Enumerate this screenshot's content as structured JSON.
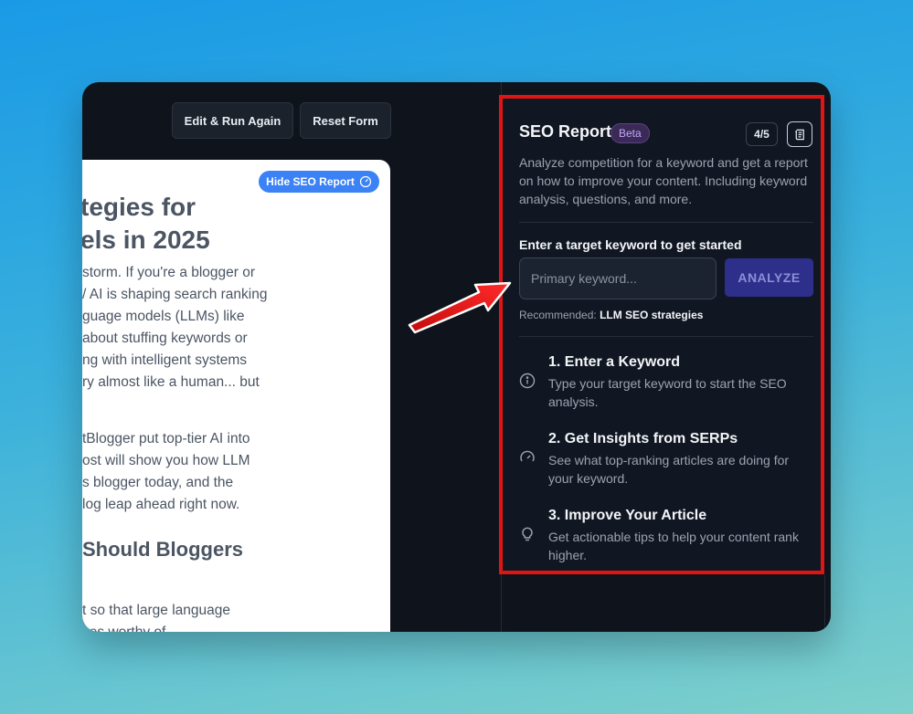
{
  "toolbar": {
    "edit_run_label": "Edit & Run Again",
    "reset_label": "Reset Form"
  },
  "article": {
    "hide_seo_label": "Hide SEO Report",
    "heading_lines": [
      "tegies for",
      "els in 2025"
    ],
    "para1": [
      "storm. If you're a blogger or",
      "/ AI is shaping search ranking",
      "guage models (LLMs) like",
      "about stuffing keywords or",
      "ng with intelligent systems",
      "ry almost like a human... but"
    ],
    "para2": [
      "tBlogger put top-tier AI into",
      "ost will show you how LLM",
      "s blogger today, and the",
      "log leap ahead right now."
    ],
    "subheading": "Should Bloggers",
    "para3": [
      "t so that large language",
      "ces worthy of"
    ]
  },
  "seo": {
    "title": "SEO Report",
    "beta": "Beta",
    "count": "4/5",
    "description": "Analyze competition for a keyword and get a report on how to improve your content. Including keyword analysis, questions, and more.",
    "keyword_label": "Enter a target keyword to get started",
    "keyword_placeholder": "Primary keyword...",
    "analyze_label": "ANALYZE",
    "recommended_prefix": "Recommended:",
    "recommended_value": "LLM SEO strategies",
    "steps": [
      {
        "title": "1. Enter a Keyword",
        "desc": "Type your target keyword to start the SEO analysis.",
        "icon": "info-icon"
      },
      {
        "title": "2. Get Insights from SERPs",
        "desc": "See what top-ranking articles are doing for your keyword.",
        "icon": "gauge-icon"
      },
      {
        "title": "3. Improve Your Article",
        "desc": "Get actionable tips to help your content rank higher.",
        "icon": "lightbulb-icon"
      }
    ]
  },
  "colors": {
    "highlight_border": "#e11414",
    "analyze_bg": "#2e2f8a",
    "hide_seo_bg": "#3b82f6",
    "beta_text": "#c4a7ff"
  }
}
